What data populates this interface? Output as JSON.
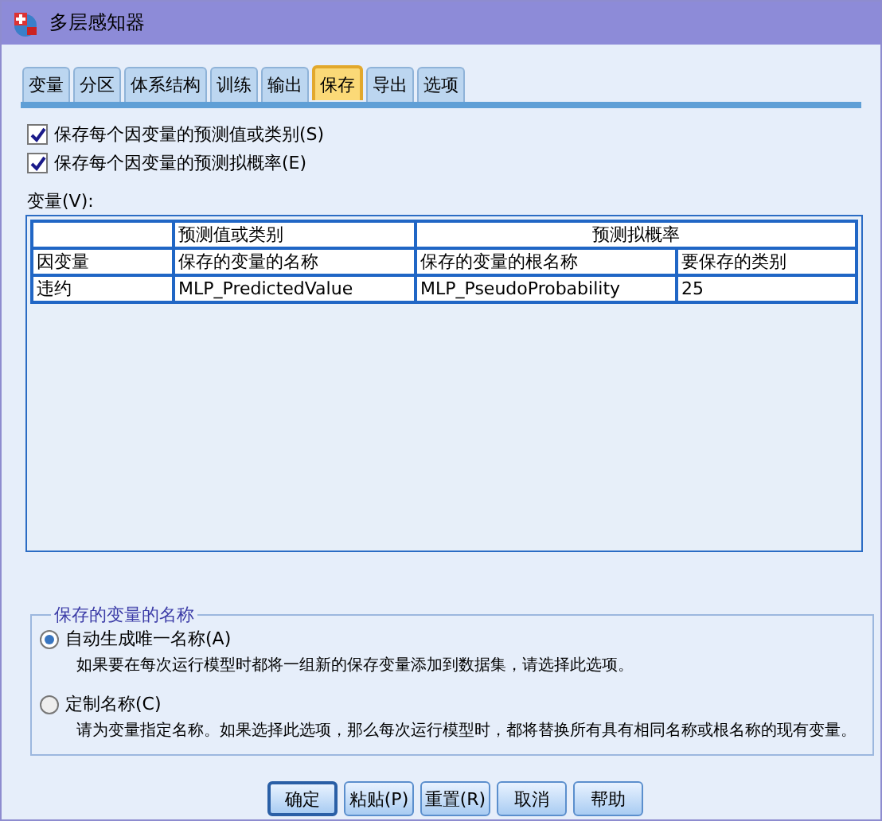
{
  "window": {
    "title": "多层感知器"
  },
  "tabs": [
    {
      "label": "变量",
      "selected": false
    },
    {
      "label": "分区",
      "selected": false
    },
    {
      "label": "体系结构",
      "selected": false
    },
    {
      "label": "训练",
      "selected": false
    },
    {
      "label": "输出",
      "selected": false
    },
    {
      "label": "保存",
      "selected": true
    },
    {
      "label": "导出",
      "selected": false
    },
    {
      "label": "选项",
      "selected": false
    }
  ],
  "checkboxes": [
    {
      "label": "保存每个因变量的预测值或类别(S)",
      "checked": true
    },
    {
      "label": "保存每个因变量的预测拟概率(E)",
      "checked": true
    }
  ],
  "variables": {
    "label": "变量(V):",
    "group_headers": {
      "predicted_value": "预测值或类别",
      "pseudo_probability": "预测拟概率"
    },
    "columns": [
      "因变量",
      "保存的变量的名称",
      "保存的变量的根名称",
      "要保存的类别"
    ],
    "rows": [
      [
        "违约",
        "MLP_PredictedValue",
        "MLP_PseudoProbability",
        "25"
      ]
    ]
  },
  "naming": {
    "title": "保存的变量的名称",
    "options": [
      {
        "label": "自动生成唯一名称(A)",
        "description": "如果要在每次运行模型时都将一组新的保存变量添加到数据集，请选择此选项。",
        "selected": true
      },
      {
        "label": "定制名称(C)",
        "description": "请为变量指定名称。如果选择此选项，那么每次运行模型时，都将替换所有具有相同名称或根名称的现有变量。",
        "selected": false
      }
    ]
  },
  "buttons": [
    {
      "label": "确定",
      "default": true
    },
    {
      "label": "粘贴(P)",
      "default": false
    },
    {
      "label": "重置(R)",
      "default": false
    },
    {
      "label": "取消",
      "default": false
    },
    {
      "label": "帮助",
      "default": false
    }
  ]
}
